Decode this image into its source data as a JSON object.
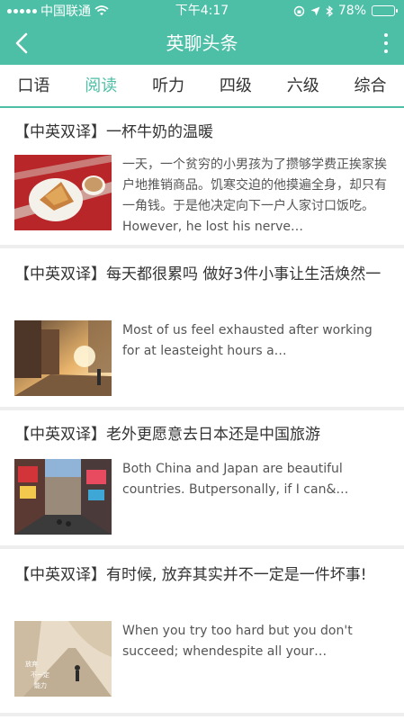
{
  "status_bar": {
    "carrier": "中国联通",
    "time": "下午4:17",
    "battery": "78%",
    "battery_level": 0.78
  },
  "nav": {
    "title": "英聊头条",
    "back_icon": "back-chevron-icon",
    "more_icon": "more-vertical-icon"
  },
  "tabs": [
    {
      "label": "口语"
    },
    {
      "label": "阅读",
      "active": true
    },
    {
      "label": "听力"
    },
    {
      "label": "四级"
    },
    {
      "label": "六级"
    },
    {
      "label": "综合"
    }
  ],
  "articles": [
    {
      "title": "【中英双译】一杯牛奶的温暖",
      "summary": "一天，一个贫穷的小男孩为了攒够学费正挨家挨户地推销商品。饥寒交迫的他摸遍全身，却只有一角钱。于是他决定向下一户人家讨口饭吃。However, he lost his nerve…",
      "image": "milk-pastry-photo"
    },
    {
      "title": "【中英双译】每天都很累吗 做好3件小事让生活焕然一",
      "summary": "Most of us feel exhausted after working for at leasteight hours a…",
      "image": "city-street-sunset-photo"
    },
    {
      "title": "【中英双译】老外更愿意去日本还是中国旅游",
      "summary": "Both China and Japan are beautiful countries. Butpersonally, if I can&…",
      "image": "shopping-street-photo"
    },
    {
      "title": "【中英双译】有时候, 放弃其实并不一定是一件坏事!",
      "summary": "When you try too hard but you don't succeed; whendespite all your…",
      "image": "person-walking-photo",
      "image_caption": "放弃 不一定 是 一种 能力"
    }
  ]
}
